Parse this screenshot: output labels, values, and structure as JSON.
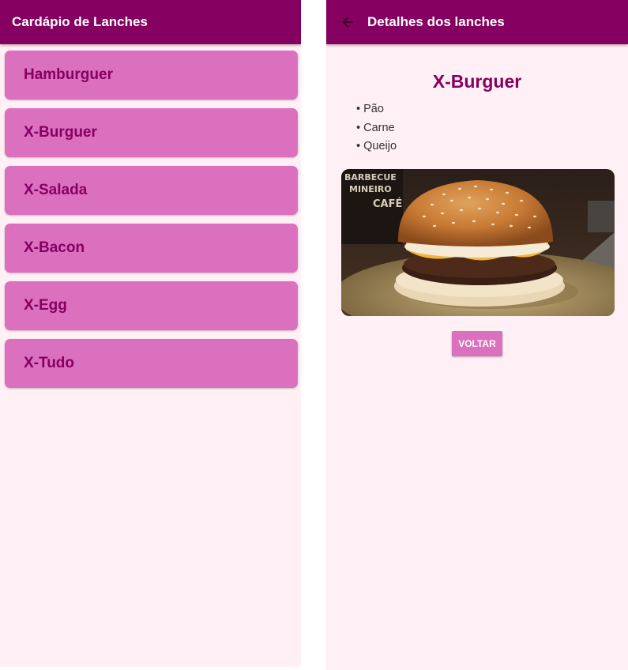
{
  "menu_screen": {
    "title": "Cardápio de Lanches",
    "items": [
      {
        "label": "Hamburguer"
      },
      {
        "label": "X-Burguer"
      },
      {
        "label": "X-Salada"
      },
      {
        "label": "X-Bacon"
      },
      {
        "label": "X-Egg"
      },
      {
        "label": "X-Tudo"
      }
    ]
  },
  "detail_screen": {
    "title": "Detalhes dos lanches",
    "back_icon": "arrow-left-icon",
    "item_name": "X-Burguer",
    "ingredients": [
      "• Pão",
      "• Carne",
      "• Queijo"
    ],
    "back_button_label": "VOLTAR",
    "image_sign_text": [
      "BARBECUE",
      "MINEIRO",
      "CAFÉ"
    ]
  },
  "colors": {
    "app_bar": "#860061",
    "item_background": "#da70be",
    "item_text": "#860061",
    "screen_background": "#fff0f5"
  }
}
